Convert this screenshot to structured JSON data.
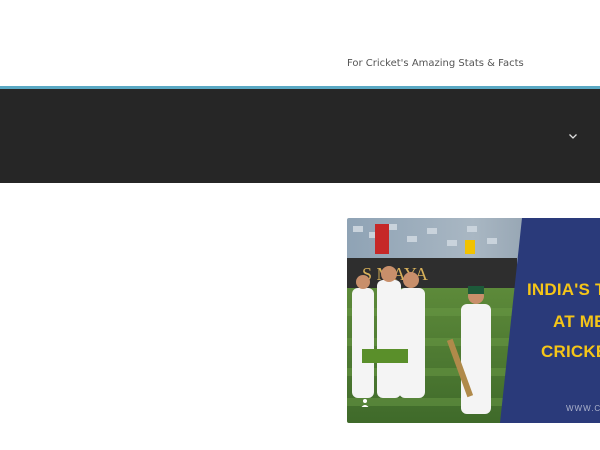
{
  "header": {
    "tagline": "For Cricket's Amazing Stats & Facts"
  },
  "nav": {
    "toggle_icon": "chevron-down-icon"
  },
  "featured": {
    "banner_line1": "INDIA'S T",
    "banner_line2": "AT ME",
    "banner_line3": "CRICKE",
    "banner_url": "WWW.C",
    "stadium_sign": "S  MAYA",
    "author_icon": "user-icon"
  },
  "colors": {
    "accent": "#5aa9c4",
    "nav_bg": "#262626",
    "banner_bg": "#2a3a7a",
    "banner_text": "#f5c518",
    "badge": "#5a8f2a"
  }
}
